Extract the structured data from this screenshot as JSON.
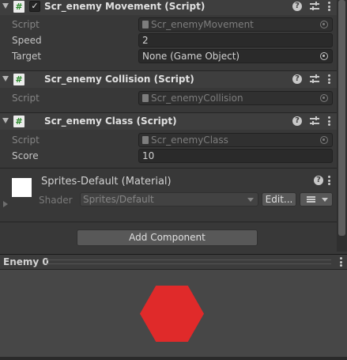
{
  "components": [
    {
      "title": "Scr_enemy Movement (Script)",
      "enabled": true,
      "fields": [
        {
          "label": "Script",
          "value": "Scr_enemyMovement",
          "disabled": true
        },
        {
          "label": "Speed",
          "value": "2",
          "disabled": false
        },
        {
          "label": "Target",
          "value": "None (Game Object)",
          "disabled": false
        }
      ]
    },
    {
      "title": "Scr_enemy Collision (Script)",
      "fields": [
        {
          "label": "Script",
          "value": "Scr_enemyCollision",
          "disabled": true
        }
      ]
    },
    {
      "title": "Scr_enemy Class (Script)",
      "fields": [
        {
          "label": "Script",
          "value": "Scr_enemyClass",
          "disabled": true
        },
        {
          "label": "Score",
          "value": "10",
          "disabled": false
        }
      ]
    }
  ],
  "material": {
    "title": "Sprites-Default (Material)",
    "shader_label": "Shader",
    "shader_value": "Sprites/Default",
    "edit_label": "Edit..."
  },
  "add_component_label": "Add Component",
  "preview": {
    "title": "Enemy 0",
    "shape_color": "#e02a2a"
  },
  "icons": {
    "script": "#",
    "checkmark": "✓",
    "help": "?"
  }
}
